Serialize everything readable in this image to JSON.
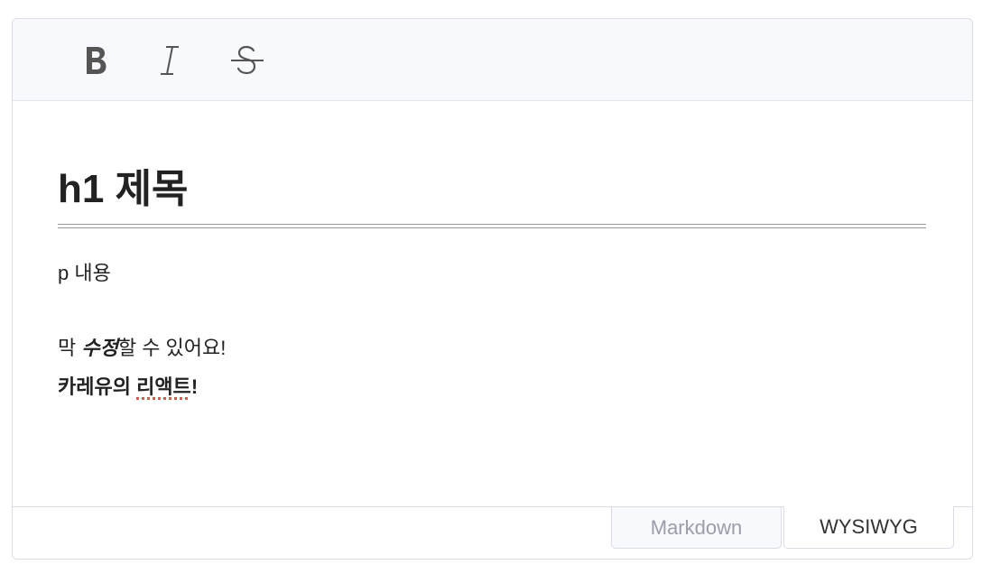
{
  "toolbar": {
    "buttons": [
      {
        "name": "bold",
        "icon": "bold-icon"
      },
      {
        "name": "italic",
        "icon": "italic-icon"
      },
      {
        "name": "strike",
        "icon": "strikethrough-icon"
      }
    ]
  },
  "content": {
    "heading": "h1 제목",
    "paragraph1": "p 내용",
    "paragraph2": {
      "prefix": "막 ",
      "bold_italic": "수정",
      "suffix": "할 수 있어요!"
    },
    "paragraph3": {
      "part1": "카레유의 ",
      "misspelled": "리액트",
      "part2": "!"
    }
  },
  "modes": {
    "markdown_label": "Markdown",
    "wysiwyg_label": "WYSIWYG",
    "active": "WYSIWYG"
  },
  "colors": {
    "toolbar_bg": "#f7f9fc",
    "border": "#dadde6",
    "text": "#222222",
    "spellcheck": "#e5534b",
    "inactive_tab_text": "#9a9ea8"
  }
}
